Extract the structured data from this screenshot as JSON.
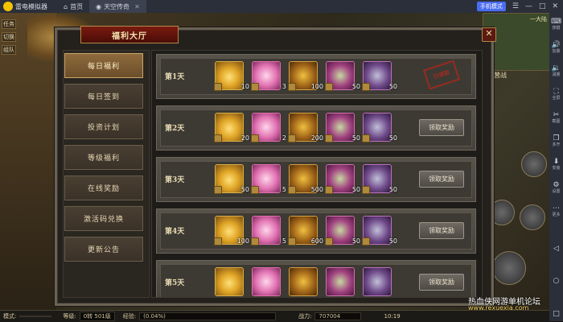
{
  "emulator": {
    "app_name": "雷电模拟器",
    "tabs": [
      {
        "label": "首页"
      },
      {
        "label": "天空传奇"
      }
    ],
    "phone_mode": "手机模式",
    "toolbar": [
      {
        "icon": "keyboard-icon",
        "label": "按键"
      },
      {
        "icon": "volume-up-icon",
        "label": "加量"
      },
      {
        "icon": "volume-down-icon",
        "label": "减量"
      },
      {
        "icon": "fullscreen-icon",
        "label": "全屏"
      },
      {
        "icon": "screenshot-icon",
        "label": "截图"
      },
      {
        "icon": "multi-instance-icon",
        "label": "多开"
      },
      {
        "icon": "install-icon",
        "label": "安装"
      },
      {
        "icon": "settings-icon",
        "label": "设置"
      },
      {
        "icon": "more-icon",
        "label": "更多"
      }
    ]
  },
  "game": {
    "left_buttons": [
      "任务",
      "切换",
      "组队"
    ],
    "map_label": "一大陆",
    "event_label": "阵营战"
  },
  "panel": {
    "title": "福利大厅",
    "close": "✕",
    "menu": [
      {
        "label": "每日福利",
        "active": true
      },
      {
        "label": "每日签到",
        "active": false
      },
      {
        "label": "投资计划",
        "active": false
      },
      {
        "label": "等级福利",
        "active": false
      },
      {
        "label": "在线奖励",
        "active": false
      },
      {
        "label": "激活码兑换",
        "active": false
      },
      {
        "label": "更新公告",
        "active": false
      }
    ],
    "rows": [
      {
        "day": "第1天",
        "items": [
          {
            "type": "gold",
            "count": "10"
          },
          {
            "type": "bill",
            "count": "3"
          },
          {
            "type": "sword",
            "count": "100"
          },
          {
            "type": "gem",
            "count": "50"
          },
          {
            "type": "ore",
            "count": "50"
          }
        ],
        "status": "claimed",
        "status_text": "已领取"
      },
      {
        "day": "第2天",
        "items": [
          {
            "type": "gold",
            "count": "20"
          },
          {
            "type": "bill",
            "count": "2"
          },
          {
            "type": "sword",
            "count": "200"
          },
          {
            "type": "gem",
            "count": "50"
          },
          {
            "type": "ore",
            "count": "50"
          }
        ],
        "status": "claim",
        "status_text": "领取奖励"
      },
      {
        "day": "第3天",
        "items": [
          {
            "type": "gold",
            "count": "50"
          },
          {
            "type": "bill",
            "count": "5"
          },
          {
            "type": "sword",
            "count": "500"
          },
          {
            "type": "gem",
            "count": "50"
          },
          {
            "type": "ore",
            "count": "50"
          }
        ],
        "status": "claim",
        "status_text": "领取奖励"
      },
      {
        "day": "第4天",
        "items": [
          {
            "type": "gold",
            "count": "100"
          },
          {
            "type": "bill",
            "count": "5"
          },
          {
            "type": "sword",
            "count": "600"
          },
          {
            "type": "gem",
            "count": "50"
          },
          {
            "type": "ore",
            "count": "50"
          }
        ],
        "status": "claim",
        "status_text": "领取奖励"
      },
      {
        "day": "第5天",
        "items": [
          {
            "type": "gold",
            "count": ""
          },
          {
            "type": "bill",
            "count": ""
          },
          {
            "type": "sword",
            "count": ""
          },
          {
            "type": "gem",
            "count": ""
          },
          {
            "type": "ore",
            "count": ""
          }
        ],
        "status": "claim",
        "status_text": "领取奖励"
      }
    ]
  },
  "status": {
    "mode_label": "模式:",
    "level_label": "等级:",
    "level_value": "0转 501级",
    "exp_label": "经验:",
    "exp_value": "(0.04%)",
    "power_label": "战力:",
    "power_value": "707004",
    "time": "10:19"
  },
  "watermark": {
    "line1": "热血侠网游单机论坛",
    "line2": "www.rexuexia.com"
  }
}
